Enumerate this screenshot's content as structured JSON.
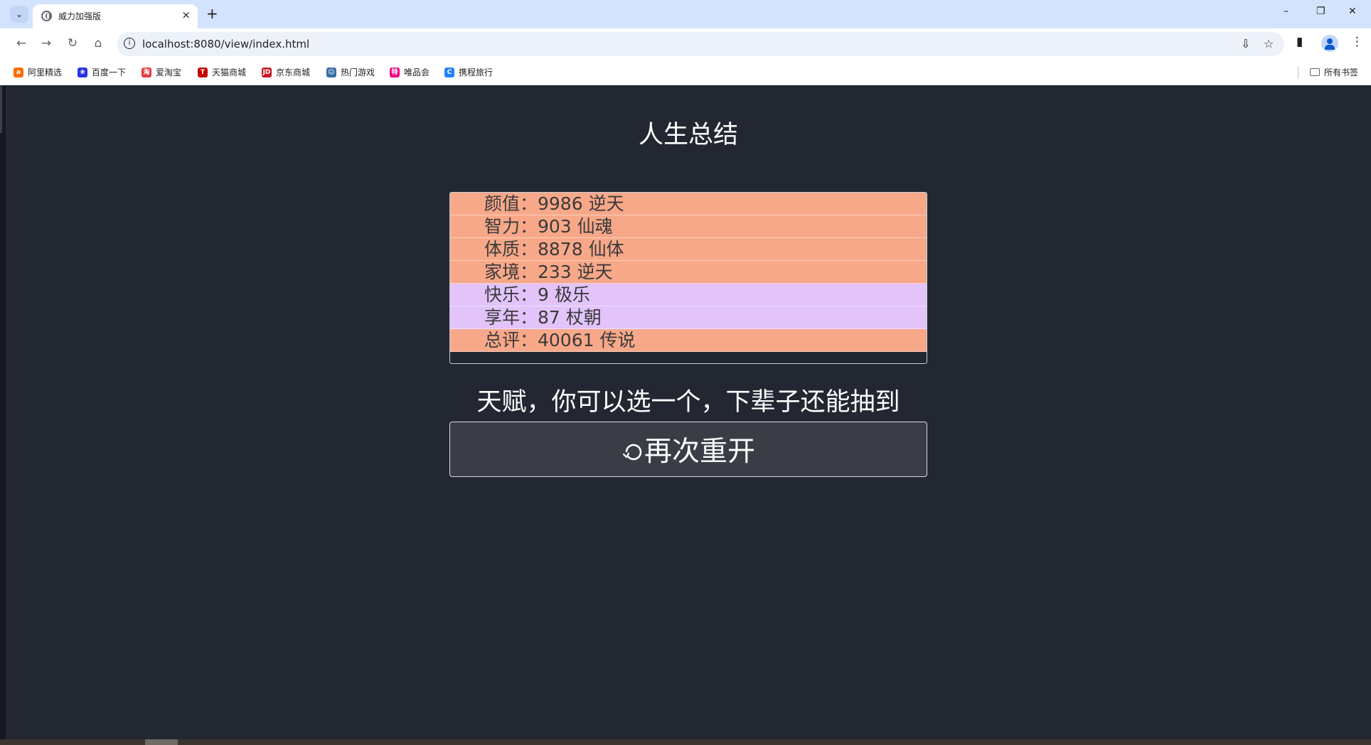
{
  "browser": {
    "tab_title": "威力加强版",
    "url": "localhost:8080/view/index.html",
    "window_controls": {
      "minimize": "–",
      "restore": "❐",
      "close": "✕"
    },
    "bookmarks": [
      {
        "label": "阿里精选",
        "icon": "alibaba-icon",
        "color": "#ff6a00",
        "glyph": "a"
      },
      {
        "label": "百度一下",
        "icon": "baidu-paw-icon",
        "color": "#2932e1",
        "glyph": "❀"
      },
      {
        "label": "爱淘宝",
        "icon": "taobao-icon",
        "color": "#e4393c",
        "glyph": "淘"
      },
      {
        "label": "天猫商城",
        "icon": "tmall-icon",
        "color": "#c40000",
        "glyph": "T"
      },
      {
        "label": "京东商城",
        "icon": "jd-icon",
        "color": "#c91623",
        "glyph": "JD"
      },
      {
        "label": "热门游戏",
        "icon": "game-icon",
        "color": "#3a6ea5",
        "glyph": "☺"
      },
      {
        "label": "唯品会",
        "icon": "vip-icon",
        "color": "#f10180",
        "glyph": "特"
      },
      {
        "label": "携程旅行",
        "icon": "ctrip-icon",
        "color": "#2681ff",
        "glyph": "C"
      }
    ],
    "all_bookmarks_label": "所有书签"
  },
  "page": {
    "title": "人生总结",
    "stats": [
      {
        "label": "颜值：9986 逆天",
        "tone": "orange"
      },
      {
        "label": "智力：903 仙魂",
        "tone": "orange"
      },
      {
        "label": "体质：8878 仙体",
        "tone": "orange"
      },
      {
        "label": "家境：233 逆天",
        "tone": "orange"
      },
      {
        "label": "快乐：9 极乐",
        "tone": "purple"
      },
      {
        "label": "享年：87 杖朝",
        "tone": "purple"
      },
      {
        "label": "总评：40061 传说",
        "tone": "orange"
      }
    ],
    "talent_heading": "天赋，你可以选一个，下辈子还能抽到",
    "restart_label": "再次重开"
  },
  "colors": {
    "background": "#222731",
    "stat_orange": "#f7a889",
    "stat_purple": "#e2c4fb",
    "button_bg": "#3a3d46"
  }
}
